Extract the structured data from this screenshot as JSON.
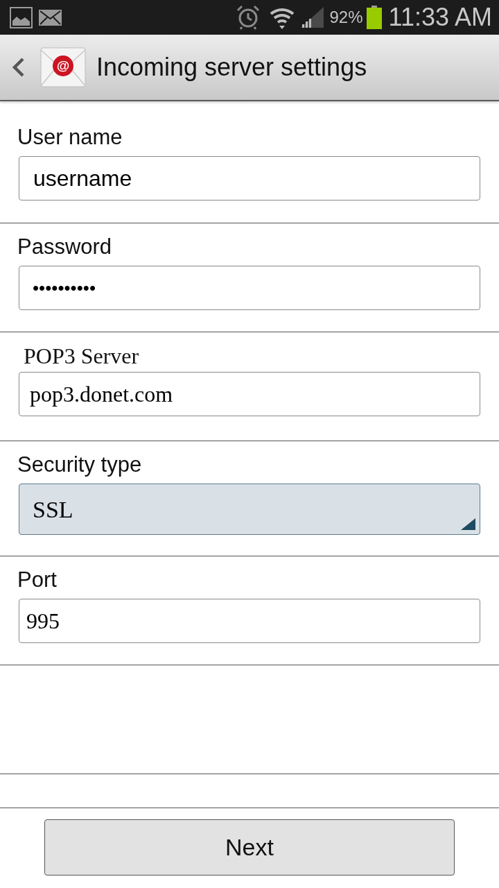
{
  "status_bar": {
    "battery_percent": "92%",
    "time": "11:33 AM"
  },
  "app_bar": {
    "icon_symbol": "@",
    "title": "Incoming server settings"
  },
  "fields": [
    {
      "kind": "text",
      "label": "User name",
      "value": "username"
    },
    {
      "kind": "password",
      "label": "Password",
      "value": "••••••••••"
    },
    {
      "kind": "text",
      "label": "POP3 Server",
      "value": "pop3.donet.com"
    },
    {
      "kind": "select",
      "label": "Security type",
      "value": "SSL"
    },
    {
      "kind": "text",
      "label": "Port",
      "value": "995"
    }
  ],
  "buttons": [
    {
      "label": "Next"
    }
  ]
}
